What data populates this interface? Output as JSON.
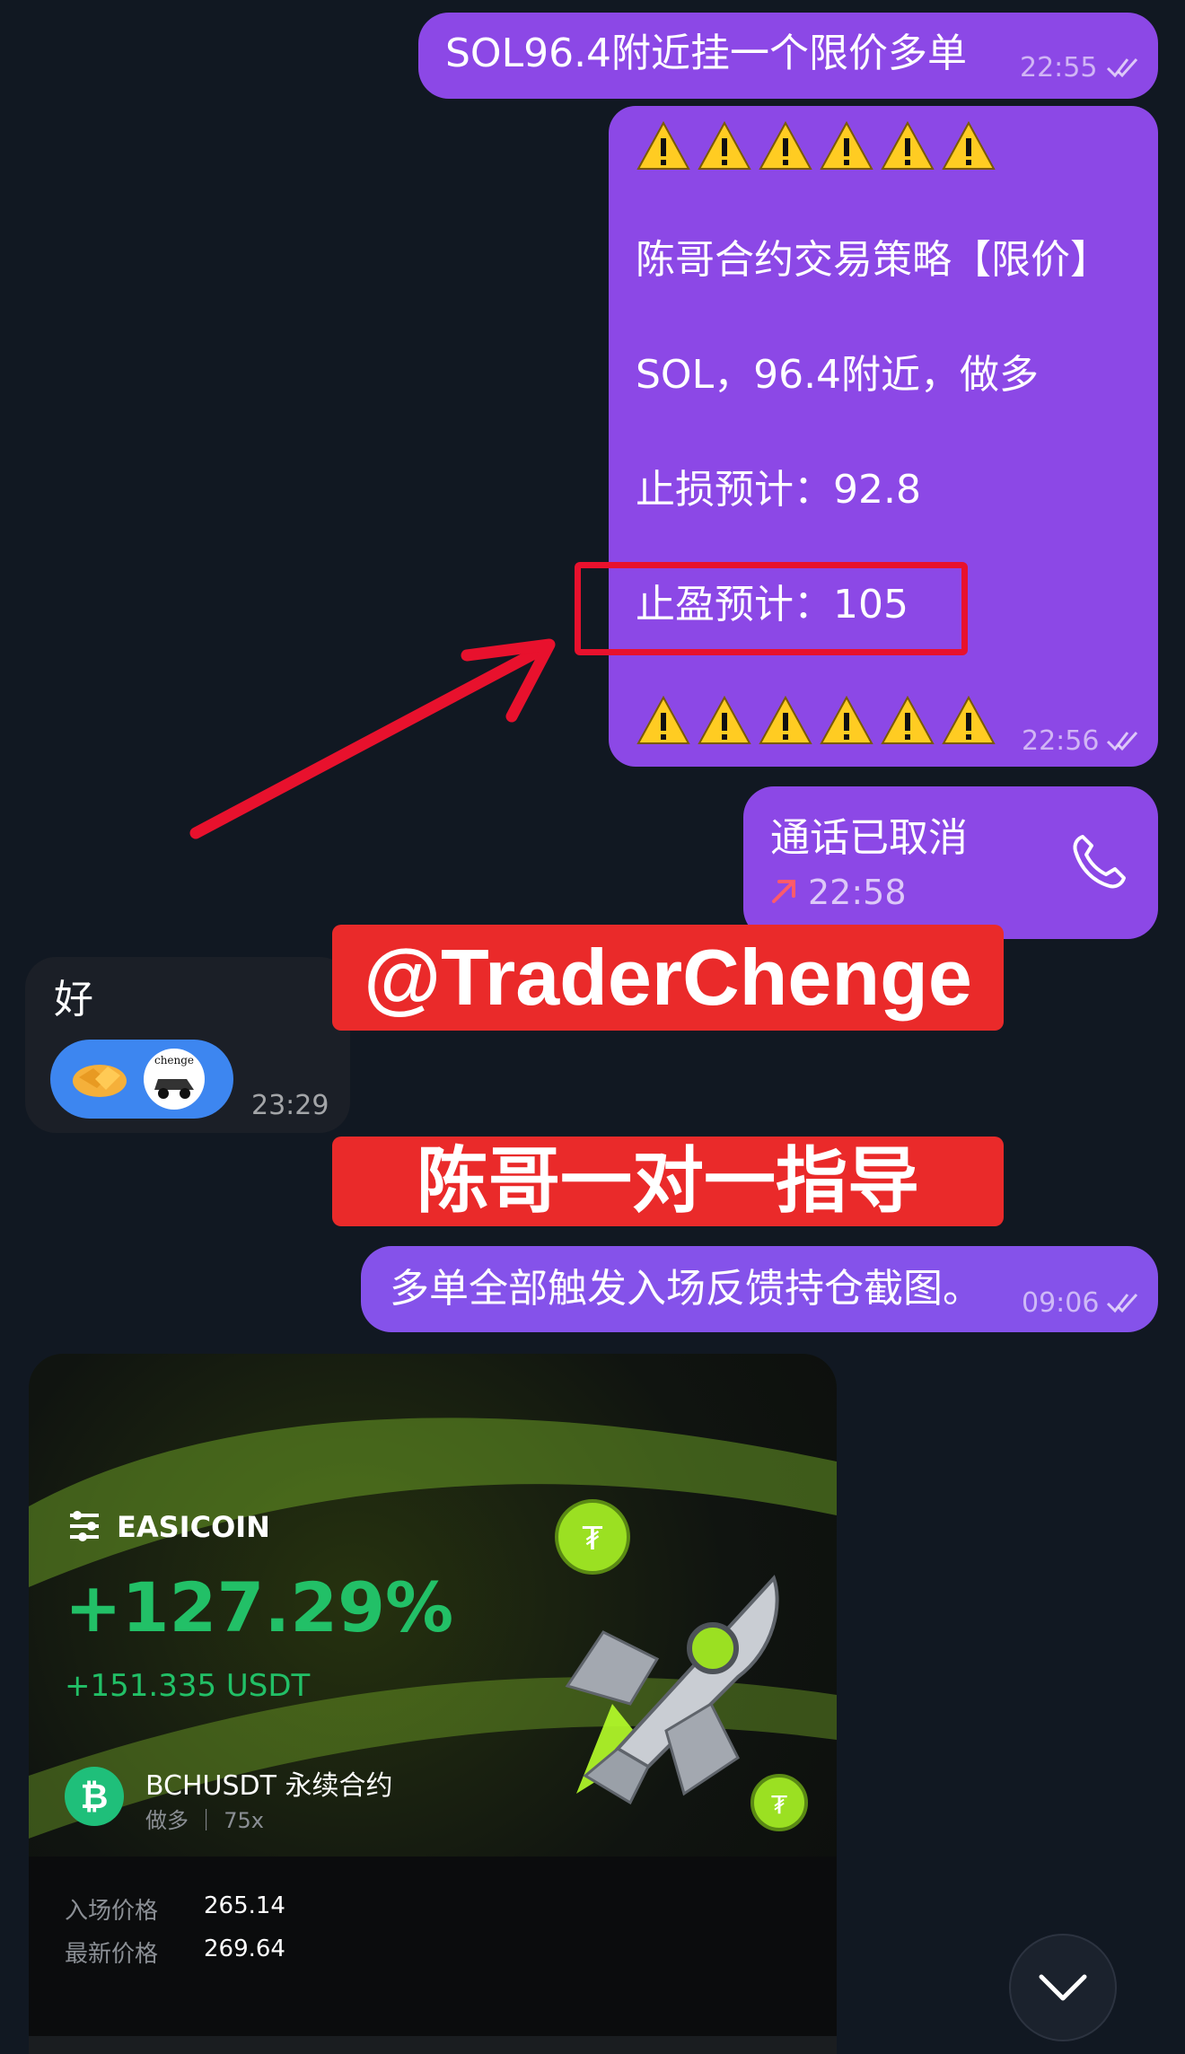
{
  "messages": {
    "m1": {
      "text": "SOL96.4附近挂一个限价多单",
      "time": "22:55"
    },
    "m2": {
      "line1": "陈哥合约交易策略【限价】",
      "line2": "SOL，96.4附近，做多",
      "line3": "止损预计：92.8",
      "line4": "止盈预计：105",
      "time": "22:56"
    },
    "call": {
      "text": "通话已取消",
      "time": "22:58"
    },
    "reply": {
      "text": "好",
      "time": "23:29",
      "avatar_text": "chenge"
    },
    "m3": {
      "text": "多单全部触发入场反馈持仓截图。",
      "time": "09:06"
    }
  },
  "overlays": {
    "handle": "@TraderChenge",
    "guide": "陈哥一对一指导"
  },
  "card": {
    "brand": "EASICOIN",
    "percent": "+127.29%",
    "profit": "+151.335 USDT",
    "pair": "BCHUSDT 永续合约",
    "side_leverage": "做多 ｜ 75x",
    "entry_label": "入场价格",
    "entry_value": "265.14",
    "latest_label": "最新价格",
    "latest_value": "269.64"
  },
  "colors": {
    "outgoing_bubble": "#8c48e6",
    "highlight_box": "#e8112d",
    "profit_green": "#22c067"
  }
}
